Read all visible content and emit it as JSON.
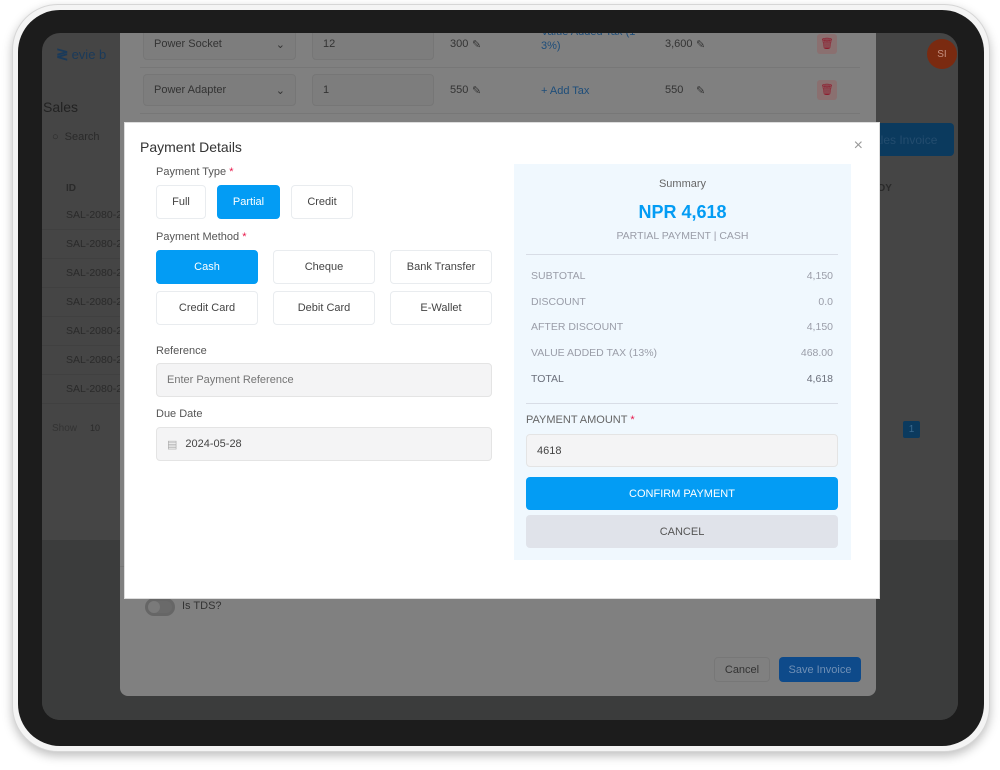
{
  "background_app": {
    "logo_text": "evie b",
    "page_title": "Sales",
    "search_placeholder": "Search",
    "column_id": "ID",
    "column_right": "DY",
    "rows": [
      "SAL-2080-2",
      "SAL-2080-2",
      "SAL-2080-2",
      "SAL-2080-2",
      "SAL-2080-2",
      "SAL-2080-2",
      "SAL-2080-2"
    ],
    "show_label": "Show",
    "page_size": "10",
    "new_invoice_button": "ales Invoice",
    "current_page": "1",
    "avatar_initials": "SI"
  },
  "invoice_modal": {
    "items": [
      {
        "product": "Power Socket",
        "qty": "12",
        "rate": "300",
        "tax": "Value Added Tax (1 3%)",
        "amount": "3,600"
      },
      {
        "product": "Power Adapter",
        "qty": "1",
        "rate": "550",
        "tax": "+ Add Tax",
        "amount": "550"
      }
    ],
    "tds_label": "Is TDS?",
    "tds_enabled": false,
    "cancel_button": "Cancel",
    "save_button": "Save Invoice"
  },
  "payment_modal": {
    "title": "Payment Details",
    "payment_type_label": "Payment Type",
    "payment_types": [
      "Full",
      "Partial",
      "Credit"
    ],
    "selected_payment_type": "Partial",
    "payment_method_label": "Payment Method",
    "payment_methods": [
      "Cash",
      "Cheque",
      "Bank Transfer",
      "Credit Card",
      "Debit Card",
      "E-Wallet"
    ],
    "selected_payment_method": "Cash",
    "reference_label": "Reference",
    "reference_placeholder": "Enter Payment Reference",
    "reference_value": "",
    "due_date_label": "Due Date",
    "due_date_value": "2024-05-28",
    "required_mark": "*",
    "summary": {
      "heading": "Summary",
      "total_display": "NPR 4,618",
      "subtitle": "PARTIAL PAYMENT | CASH",
      "rows": [
        {
          "label": "SUBTOTAL",
          "value": "4,150"
        },
        {
          "label": "DISCOUNT",
          "value": "0.0"
        },
        {
          "label": "AFTER DISCOUNT",
          "value": "4,150"
        },
        {
          "label": "VALUE ADDED TAX (13%)",
          "value": "468.00"
        },
        {
          "label": "TOTAL",
          "value": "4,618"
        }
      ],
      "payment_amount_label": "PAYMENT AMOUNT",
      "payment_amount_value": "4618",
      "confirm_button": "CONFIRM PAYMENT",
      "cancel_button": "CANCEL"
    },
    "close_icon": "×"
  },
  "colors": {
    "accent": "#039cf4",
    "required": "#e8174a",
    "summary_bg": "#f0f8fe"
  }
}
